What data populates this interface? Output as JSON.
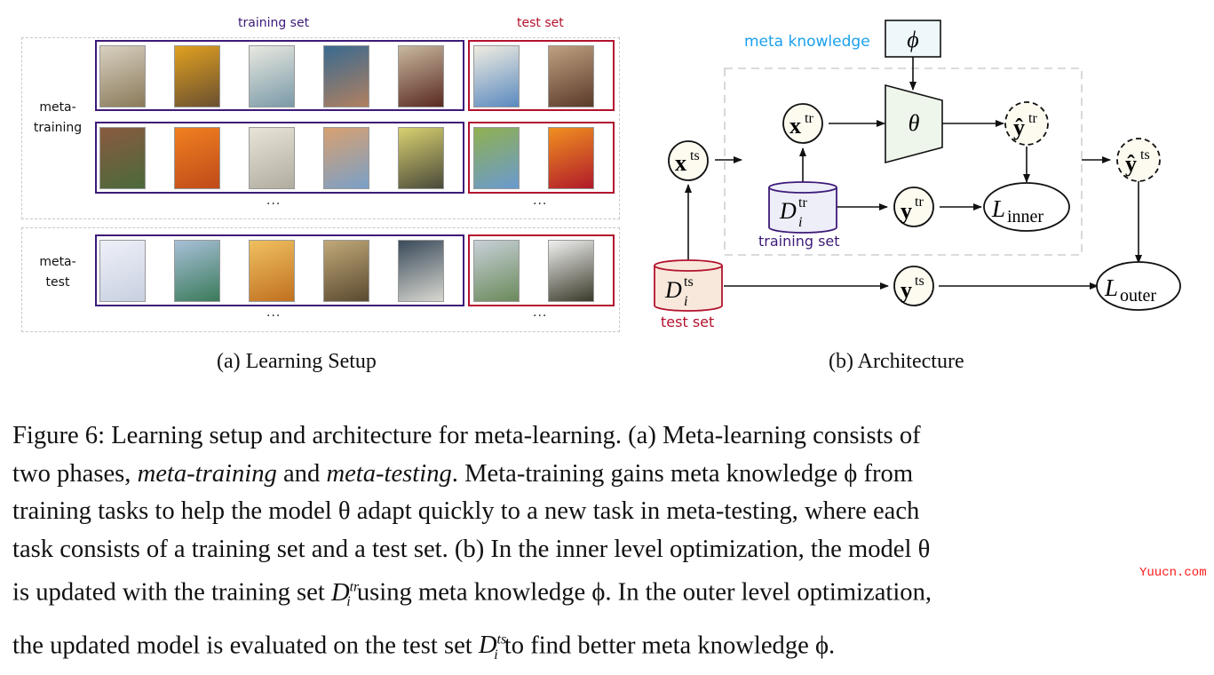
{
  "panel_a": {
    "training_set_label": "training set",
    "test_set_label": "test set",
    "rows": [
      {
        "label_line1": "meta-",
        "label_line2": "training",
        "tasks": [
          {
            "training_images": [
              "carousel-horse-rider",
              "corn-cob",
              "sailboat-with-people",
              "cliffside-village",
              "upright-piano"
            ],
            "test_images": [
              "white-sailboat",
              "carousel-rider"
            ]
          },
          {
            "training_images": [
              "finches-on-perch",
              "bowl-of-oranges",
              "photocopier",
              "church-tower",
              "wine-bottle"
            ],
            "test_images": [
              "bird-on-branch",
              "peeled-orange"
            ]
          }
        ],
        "ellipsis_train": "...",
        "ellipsis_test": "..."
      },
      {
        "label_line1": "meta-",
        "label_line2": "test",
        "tasks": [
          {
            "training_images": [
              "arctic-fox",
              "street-sign",
              "radio-telescope-sunset",
              "pipe-organ",
              "high-heel-shoe"
            ],
            "test_images": [
              "roadside-street-sign",
              "white-dog"
            ]
          }
        ],
        "ellipsis_train": "...",
        "ellipsis_test": "..."
      }
    ],
    "subcaption": "(a) Learning Setup"
  },
  "panel_b": {
    "meta_knowledge_label": "meta knowledge",
    "phi": "ϕ",
    "theta": "θ",
    "nodes": {
      "x_ts": {
        "base": "x",
        "sup": "ts"
      },
      "x_tr": {
        "base": "x",
        "sup": "tr"
      },
      "yhat_tr": {
        "base": "ŷ",
        "sup": "tr"
      },
      "yhat_ts": {
        "base": "ŷ",
        "sup": "ts"
      },
      "y_tr": {
        "base": "y",
        "sup": "tr"
      },
      "y_ts": {
        "base": "y",
        "sup": "ts"
      },
      "L_inner": {
        "base": "L",
        "sub": "inner"
      },
      "L_outer": {
        "base": "L",
        "sub": "outer"
      },
      "D_tr": {
        "base": "D",
        "sup": "tr",
        "sub": "i"
      },
      "D_ts": {
        "base": "D",
        "sup": "ts",
        "sub": "i"
      }
    },
    "training_set_label": "training set",
    "test_set_label": "test set",
    "subcaption": "(b) Architecture"
  },
  "colors": {
    "training_purple": "#3d1a78",
    "test_red": "#b3122e",
    "meta_blue": "#1aa0ee",
    "node_fill": "#fdfaf0",
    "theta_fill": "#eef5ea",
    "phi_fill": "#eef7fa",
    "dtr_fill": "#eeeef8",
    "dts_fill": "#f8e8dc"
  },
  "caption": {
    "label": "Figure 6:",
    "l1": "Learning setup and architecture for meta-learning. (a) Meta-learning consists of",
    "l2a": "two phases, ",
    "l2_it1": "meta-training",
    "l2b": " and ",
    "l2_it2": "meta-testing",
    "l2c": ". Meta-training gains meta knowledge ϕ from",
    "l3": "training tasks to help the model θ adapt quickly to a new task in meta-testing, where each",
    "l4": "task consists of a training set and a test set. (b) In the inner level optimization, the model θ",
    "l5a": "is updated with the training set ",
    "l5_D": "D",
    "l5_sup": "tr",
    "l5_sub": "i",
    "l5b": " using meta knowledge ϕ. In the outer level optimization,",
    "l6a": "the updated model is evaluated on the test set ",
    "l6_D": "D",
    "l6_sup": "ts",
    "l6_sub": "i",
    "l6b": " to find better meta knowledge ϕ."
  },
  "watermark": "Yuucn.com"
}
